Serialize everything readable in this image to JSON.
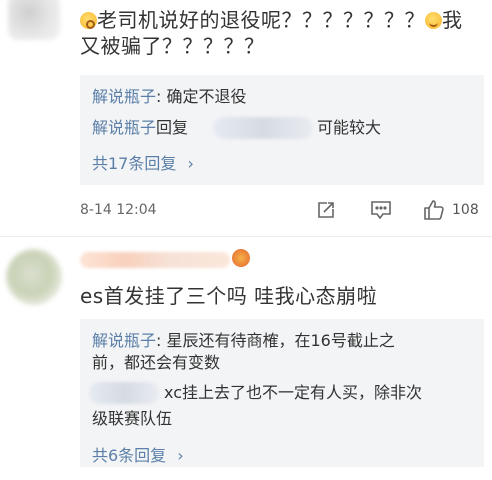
{
  "comment1": {
    "text_line1": "老司机说好的退役呢？？？？？？？",
    "text_line2_a": "我",
    "text_line2_b": "又被骗了？？？？？",
    "replies": [
      {
        "author": "解说瓶子",
        "sep": ": ",
        "text": "确定不退役"
      },
      {
        "author": "解说瓶子",
        "sep": "回复",
        "text": "可能较大"
      }
    ],
    "more_replies": "共17条回复",
    "chevron": "›",
    "timestamp": "8-14 12:04",
    "like_count": "108",
    "icons": [
      "share-icon",
      "comment-icon",
      "like-icon"
    ]
  },
  "comment2": {
    "text": "es首发挂了三个吗 哇我心态崩啦",
    "replies": [
      {
        "author": "解说瓶子",
        "sep": ": ",
        "text_line1": "星辰还有待商榷，在16号截止之",
        "text_line2": "前，都还会有变数"
      },
      {
        "text_line1": "xc挂上去了也不一定有人买，除非次",
        "text_line2": "级联赛队伍"
      }
    ],
    "more_replies": "共6条回复",
    "chevron": "›"
  },
  "colors": {
    "link": "#5b7fa8",
    "reply_bg": "#f3f4f6",
    "text": "#333333"
  }
}
